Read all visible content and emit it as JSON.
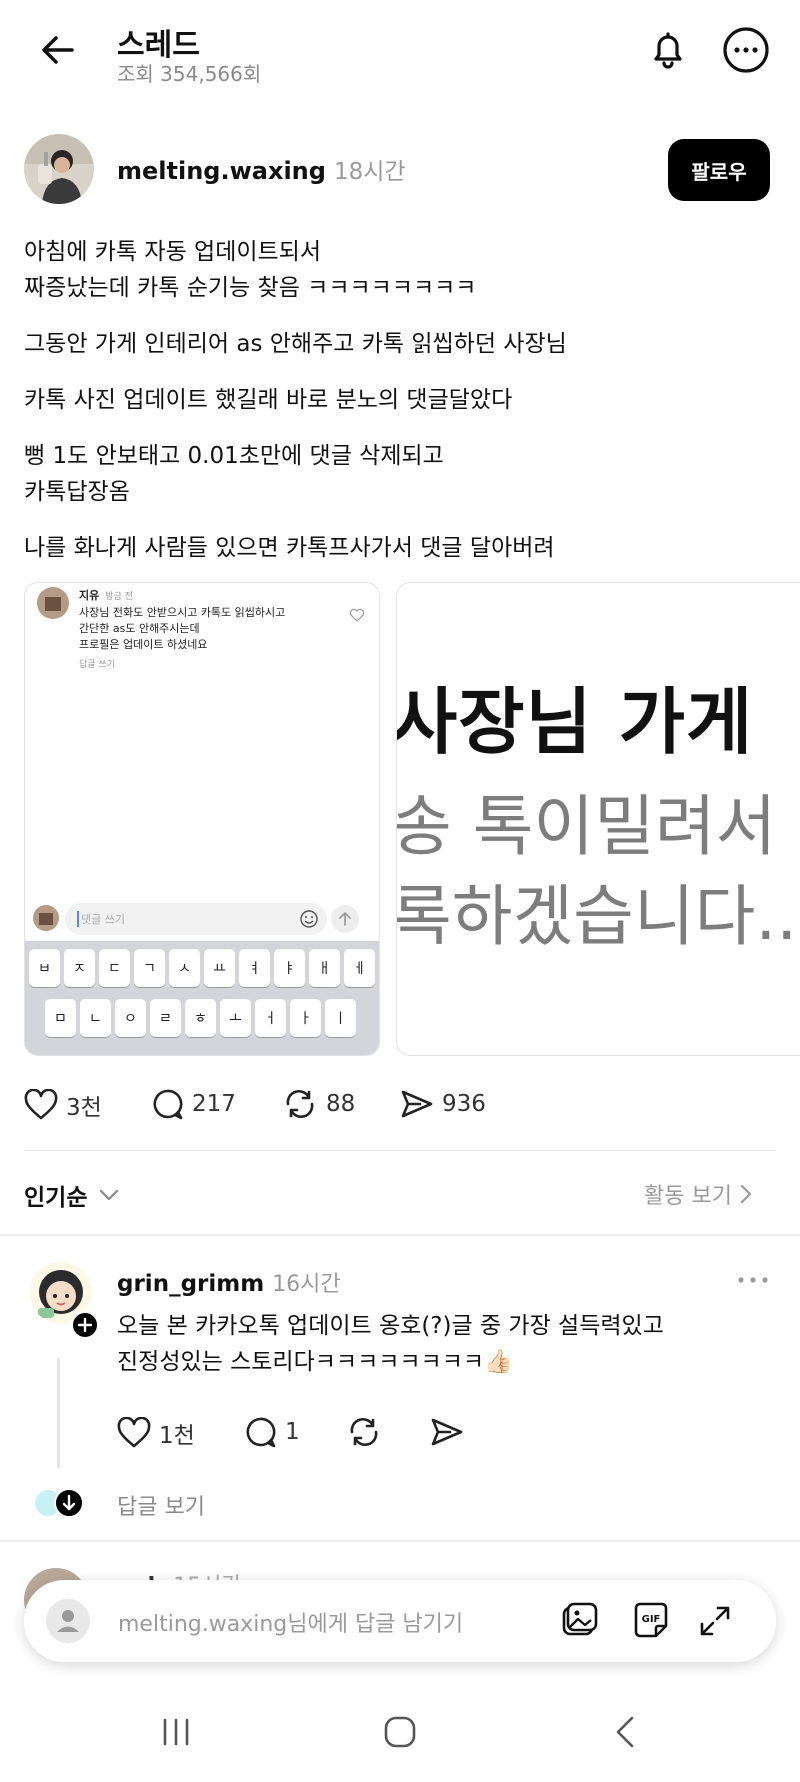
{
  "header": {
    "title": "스레드",
    "views": "조회 354,566회"
  },
  "post": {
    "username": "melting.waxing",
    "time": "18시간",
    "follow_label": "팔로우",
    "paragraphs": [
      "아침에 카톡 자동 업데이트되서\n짜증났는데 카톡 순기능 찾음 ㅋㅋㅋㅋㅋㅋㅋㅋ",
      "그동안 가게 인테리어 as 안해주고 카톡 읽씹하던 사장님",
      "카톡 사진 업데이트 했길래 바로 분노의 댓글달았다",
      "뻥 1도 안보태고 0.01초만에 댓글 삭제되고\n카톡답장옴",
      "나를 화나게 사람들 있으면 카톡프사가서 댓글 달아버려"
    ],
    "image1": {
      "commenter": "지유",
      "commenter_time": "방금 전",
      "comment_text": "사장님 전화도 안받으시고 카톡도 읽씹하시고\n간단한 as도 안해주시는데\n프로필은 업데이트 하셨네요",
      "reply_link": "답글 쓰기",
      "input_placeholder": "댓글 쓰기",
      "keyboard_row1": [
        "ㅂ",
        "ㅈ",
        "ㄷ",
        "ㄱ",
        "ㅅ",
        "ㅛ",
        "ㅕ",
        "ㅑ",
        "ㅐ",
        "ㅔ"
      ],
      "keyboard_row2": [
        "ㅁ",
        "ㄴ",
        "ㅇ",
        "ㄹ",
        "ㅎ",
        "ㅗ",
        "ㅓ",
        "ㅏ",
        "ㅣ"
      ]
    },
    "image2": {
      "line1": "사장님 가게",
      "line2": "송 톡이밀려서 (",
      "line3": "록하겠습니다..."
    },
    "stats": {
      "likes": "3천",
      "comments": "217",
      "reposts": "88",
      "shares": "936"
    }
  },
  "sort": {
    "label": "인기순",
    "activity_link": "활동 보기"
  },
  "reply": {
    "username": "grin_grimm",
    "time": "16시간",
    "text": "오늘 본 카카오톡 업데이트 옹호(?)글 중 가장 설득력있고\n진정성있는 스토리다ㅋㅋㅋㅋㅋㅋㅋㅋ👍🏻",
    "likes": "1천",
    "comments": "1",
    "view_replies": "답글 보기"
  },
  "next_reply": {
    "username_partial": "m     h",
    "time_partial": "15시간"
  },
  "reply_bar": {
    "placeholder": "melting.waxing님에게 답글 남기기"
  },
  "colors": {
    "accent": "#000000",
    "muted": "#9a9a9a",
    "divider": "#e6e6e6"
  }
}
